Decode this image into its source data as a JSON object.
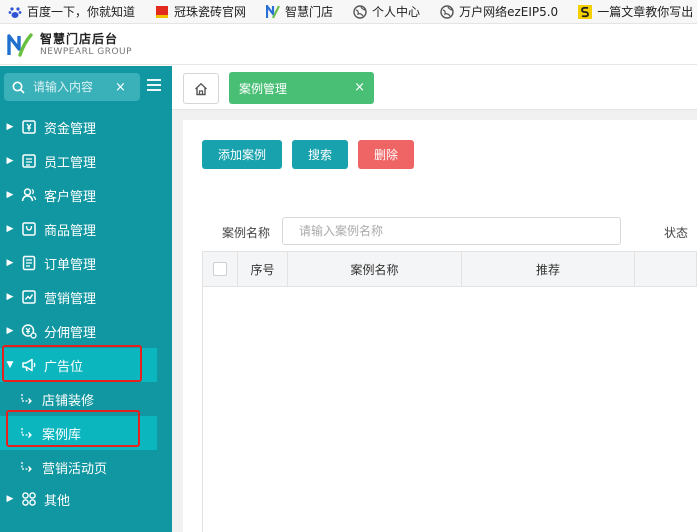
{
  "bookmarks": [
    {
      "label": "百度一下，你就知道",
      "icon": "baidu-paw-icon"
    },
    {
      "label": "冠珠瓷砖官网",
      "icon": "red-square-icon"
    },
    {
      "label": "智慧门店",
      "icon": "n-logo-icon"
    },
    {
      "label": "个人中心",
      "icon": "globe-icon"
    },
    {
      "label": "万户网络ezEIP5.0",
      "icon": "globe-icon"
    },
    {
      "label": "一篇文章教你写出",
      "icon": "s-logo-icon"
    }
  ],
  "header": {
    "title": "智慧门店后台",
    "subtitle": "NEWPEARL GROUP"
  },
  "sidebar": {
    "search_placeholder": "请输入内容",
    "search_clear": "×",
    "items": [
      {
        "label": "资金管理",
        "icon": "wallet-icon"
      },
      {
        "label": "员工管理",
        "icon": "employee-icon"
      },
      {
        "label": "客户管理",
        "icon": "customers-icon"
      },
      {
        "label": "商品管理",
        "icon": "bag-icon"
      },
      {
        "label": "订单管理",
        "icon": "order-icon"
      },
      {
        "label": "营销管理",
        "icon": "chart-icon"
      },
      {
        "label": "分佣管理",
        "icon": "commission-icon"
      },
      {
        "label": "广告位",
        "icon": "megaphone-icon"
      },
      {
        "label": "其他",
        "icon": "grid-icon"
      }
    ],
    "sub_items": [
      {
        "label": "店铺装修"
      },
      {
        "label": "案例库"
      },
      {
        "label": "营销活动页"
      }
    ]
  },
  "tabs": {
    "active_label": "案例管理",
    "close": "×"
  },
  "toolbar": {
    "add": "添加案例",
    "search": "搜索",
    "delete": "删除"
  },
  "filters": {
    "name_label": "案例名称",
    "name_placeholder": "请输入案例名称",
    "status_label": "状态"
  },
  "table": {
    "columns": [
      "序号",
      "案例名称",
      "推荐"
    ]
  },
  "colors": {
    "sidebar_bg": "#1197a1",
    "sidebar_highlight": "#0bb6bf",
    "accent": "#17a2ad",
    "tab_green": "#49bf76",
    "danger": "#ef6464",
    "annotation_red": "#e5201d"
  }
}
